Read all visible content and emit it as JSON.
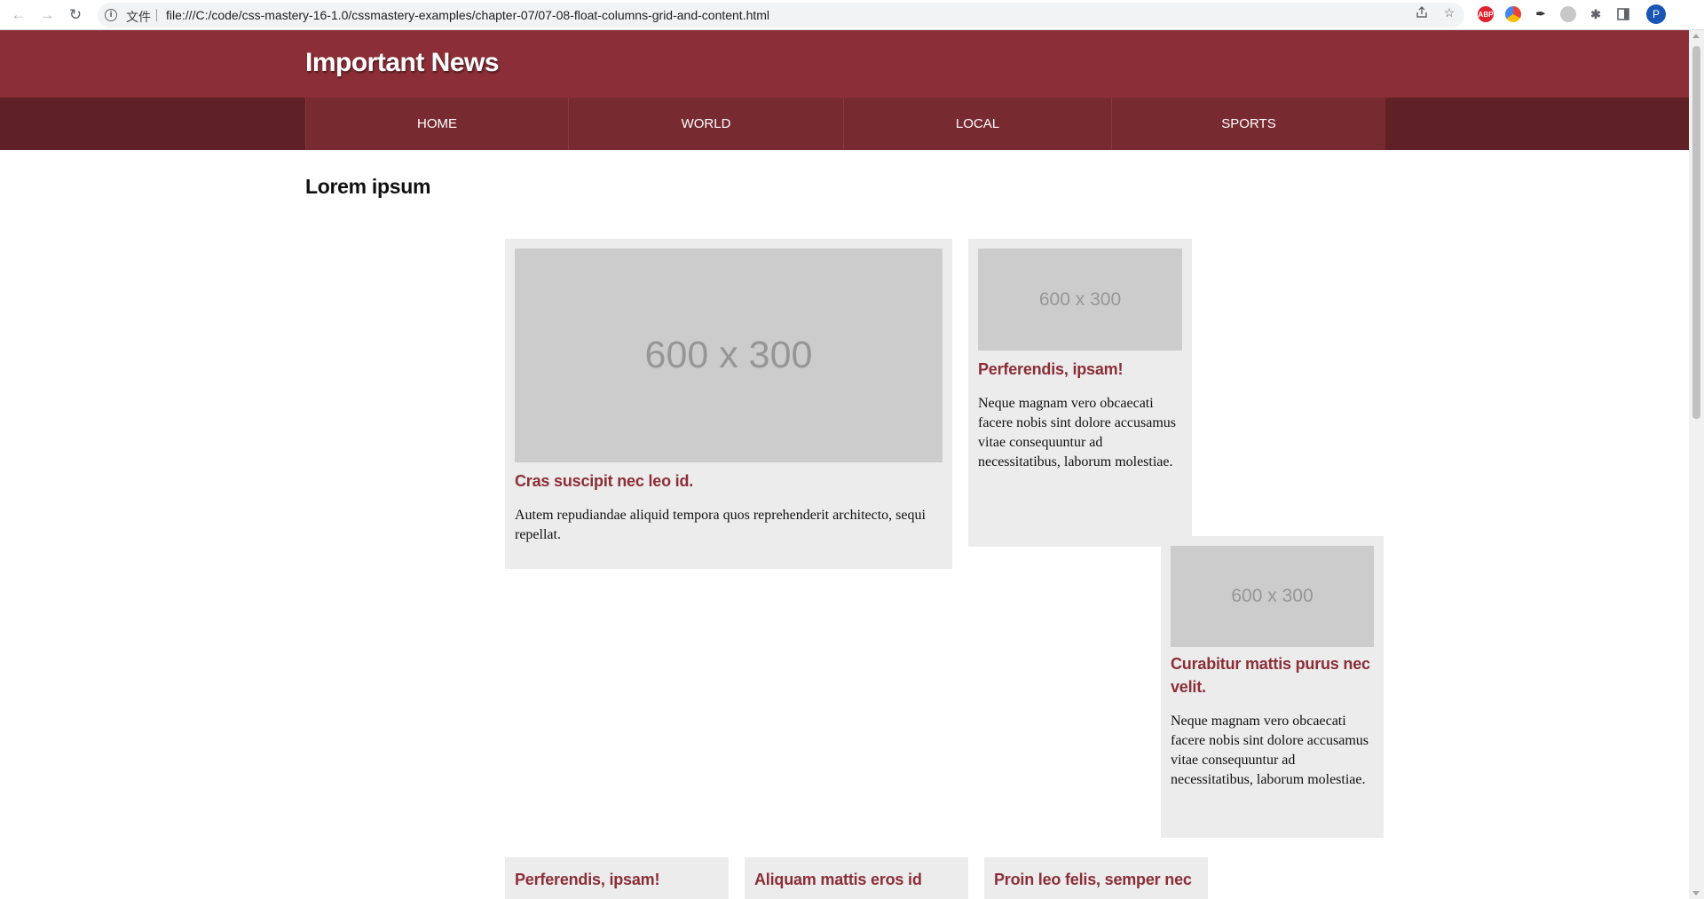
{
  "browser": {
    "scheme_label": "文件",
    "url": "file:///C:/code/css-mastery-16-1.0/cssmastery-examples/chapter-07/07-08-float-columns-grid-and-content.html",
    "extensions": [
      "ABP",
      "",
      "",
      "",
      ""
    ],
    "profile_initial": "P"
  },
  "site": {
    "title": "Important News",
    "nav": [
      "HOME",
      "WORLD",
      "LOCAL",
      "SPORTS"
    ],
    "section_title": "Lorem ipsum"
  },
  "stories": [
    {
      "image_label": "600 x 300",
      "title": "Cras suscipit nec leo id.",
      "body": "Autem repudiandae aliquid tempora quos reprehenderit architecto, sequi repellat."
    },
    {
      "image_label": "600 x 300",
      "title": "Perferendis, ipsam!",
      "body": "Neque magnam vero obcaecati facere nobis sint dolore accusamus vitae consequuntur ad necessitatibus, laborum molestiae."
    },
    {
      "image_label": "600 x 300",
      "title": "Curabitur mattis purus nec velit.",
      "body": "Neque magnam vero obcaecati facere nobis sint dolore accusamus vitae consequuntur ad necessitatibus, laborum molestiae."
    },
    {
      "title": "Perferendis, ipsam!"
    },
    {
      "title": "Aliquam mattis eros id posuere"
    },
    {
      "title": "Proin leo felis, semper nec"
    }
  ]
}
